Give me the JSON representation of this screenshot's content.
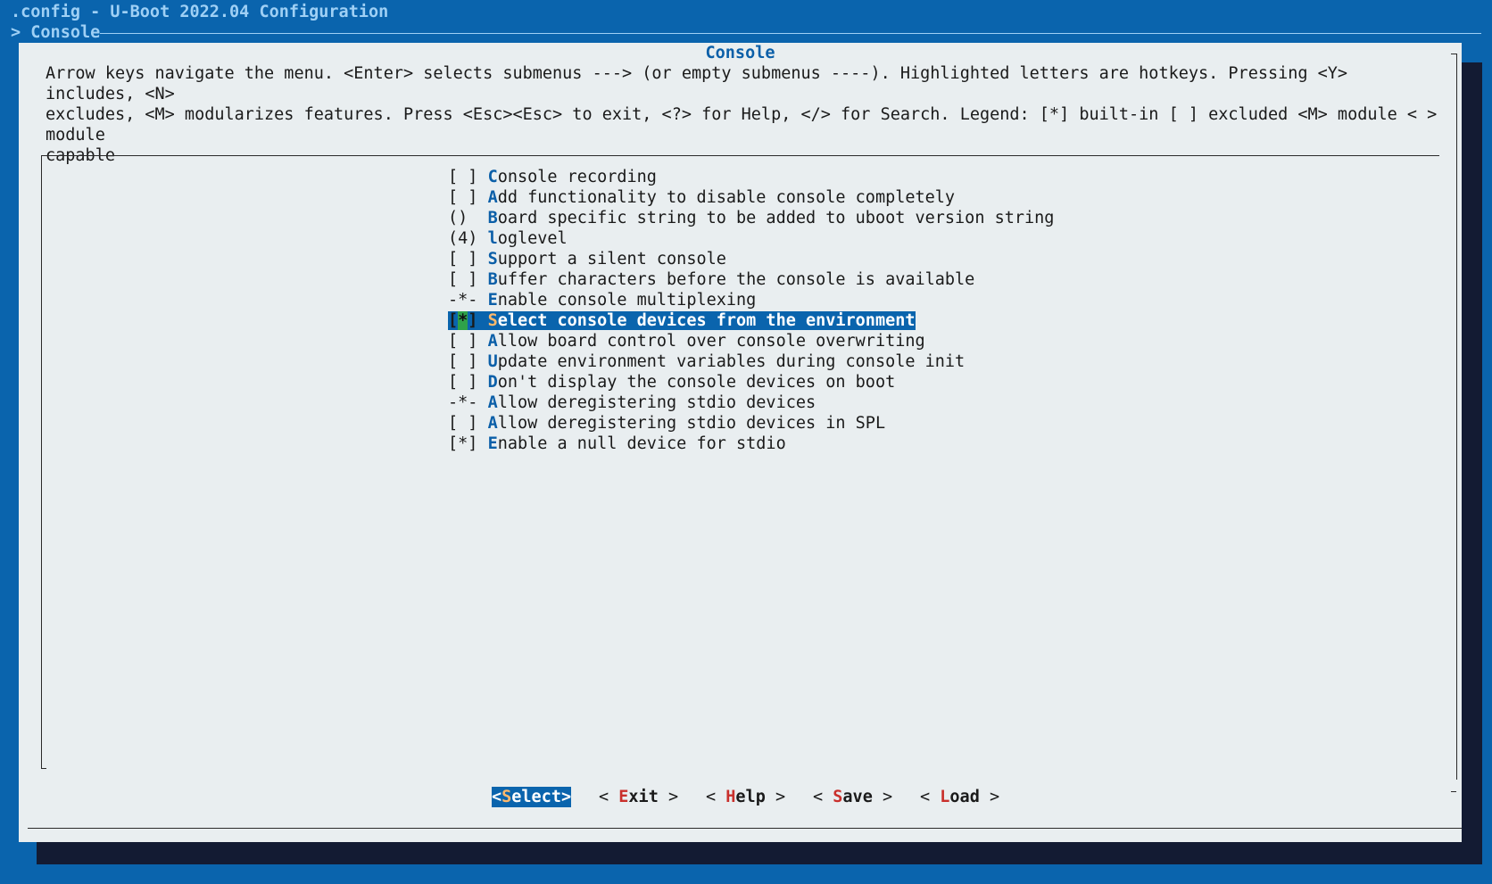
{
  "header": {
    "title": ".config - U-Boot 2022.04 Configuration",
    "breadcrumb": "> Console"
  },
  "dialog": {
    "title": "Console",
    "help_line1": "Arrow keys navigate the menu.  <Enter> selects submenus ---> (or empty submenus ----).  Highlighted letters are hotkeys.  Pressing <Y> includes, <N>",
    "help_line2": "excludes, <M> modularizes features.  Press <Esc><Esc> to exit, <?> for Help, </> for Search.  Legend: [*] built-in  [ ] excluded  <M> module  < > module",
    "help_line3": "capable"
  },
  "menu": {
    "selected_index": 7,
    "items": [
      {
        "prefix": "[ ]",
        "hotkey": "C",
        "rest": "onsole recording"
      },
      {
        "prefix": "[ ]",
        "hotkey": "A",
        "rest": "dd functionality to disable console completely"
      },
      {
        "prefix": "() ",
        "hotkey": "B",
        "rest": "oard specific string to be added to uboot version string"
      },
      {
        "prefix": "(4)",
        "hotkey": "l",
        "rest": "oglevel"
      },
      {
        "prefix": "[ ]",
        "hotkey": "S",
        "rest": "upport a silent console"
      },
      {
        "prefix": "[ ]",
        "hotkey": "B",
        "rest": "uffer characters before the console is available"
      },
      {
        "prefix": "-*-",
        "hotkey": "E",
        "rest": "nable console multiplexing"
      },
      {
        "prefix_open": "[",
        "prefix_mid": "*",
        "prefix_close": "]",
        "hotkey": "S",
        "rest": "elect console devices from the environment"
      },
      {
        "prefix": "[ ]",
        "hotkey": "A",
        "rest": "llow board control over console overwriting"
      },
      {
        "prefix": "[ ]",
        "hotkey": "U",
        "rest": "pdate environment variables during console init"
      },
      {
        "prefix": "[ ]",
        "hotkey": "D",
        "rest": "on't display the console devices on boot"
      },
      {
        "prefix": "-*-",
        "hotkey": "A",
        "rest": "llow deregistering stdio devices"
      },
      {
        "prefix": "[ ]",
        "hotkey": "A",
        "rest": "llow deregistering stdio devices in SPL"
      },
      {
        "prefix": "[*]",
        "hotkey": "E",
        "rest": "nable a null device for stdio"
      }
    ]
  },
  "buttons": {
    "select": {
      "open": "<",
      "hotkey": "S",
      "rest": "elect",
      "close": ">"
    },
    "exit": {
      "open": "< ",
      "hotkey": "E",
      "rest": "xit",
      "close": " >"
    },
    "help": {
      "open": "< ",
      "hotkey": "H",
      "rest": "elp",
      "close": " >"
    },
    "save": {
      "open": "< ",
      "hotkey": "S",
      "rest": "ave",
      "close": " >"
    },
    "load": {
      "open": "< ",
      "hotkey": "L",
      "rest": "oad",
      "close": " >"
    }
  },
  "colors": {
    "background": "#0a64ad",
    "dialog": "#e9eef0",
    "hotkey": "#0b5fa8",
    "button_hotkey": "#c9302c",
    "selected_hotkey": "#ffb86b",
    "cursor": "#2fa24a"
  }
}
